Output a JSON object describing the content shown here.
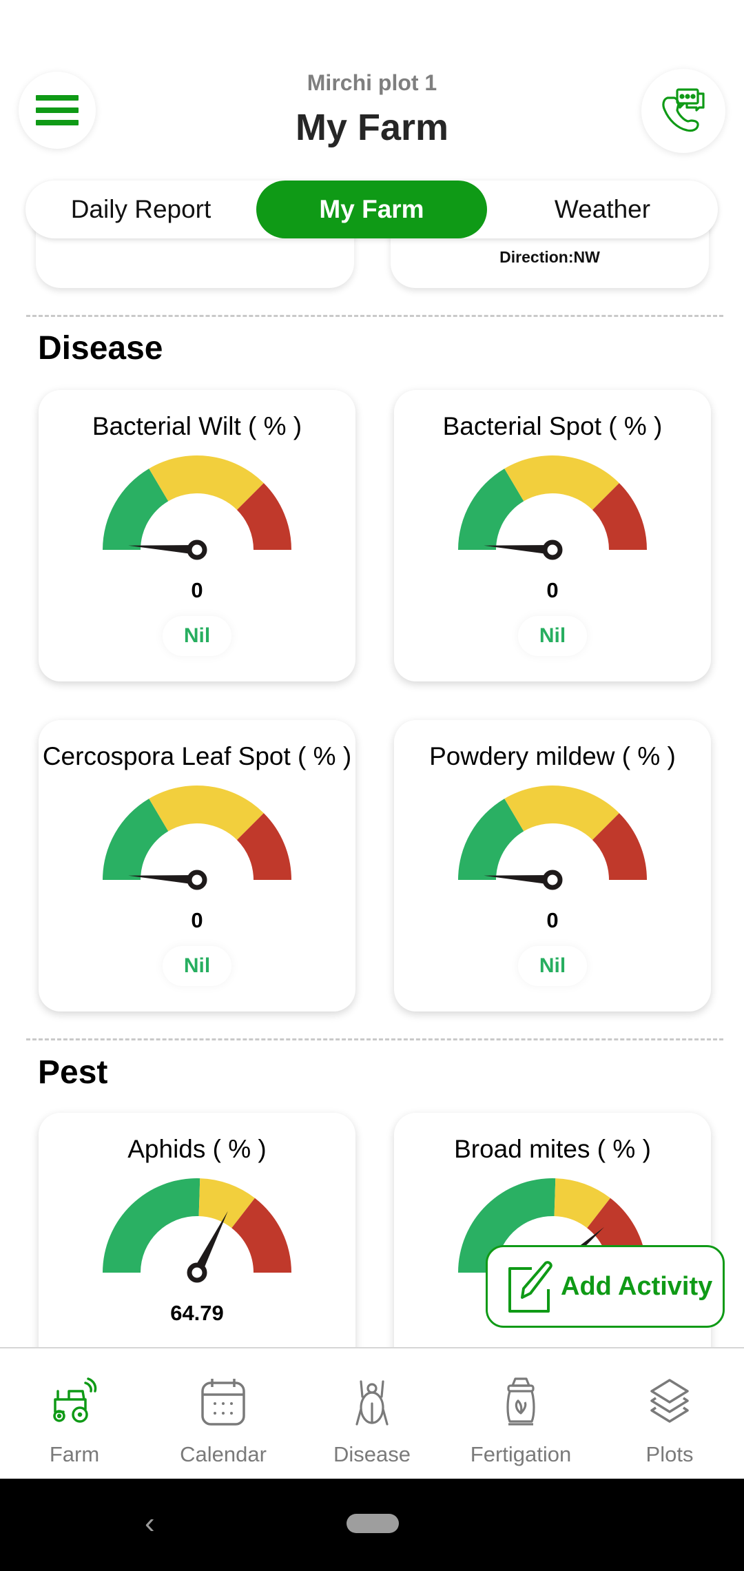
{
  "header": {
    "subtitle": "Mirchi plot 1",
    "title": "My Farm",
    "menu_icon": "hamburger-menu-icon",
    "support_icon": "phone-chat-support-icon"
  },
  "tabs": [
    {
      "label": "Daily Report",
      "active": false
    },
    {
      "label": "My Farm",
      "active": true
    },
    {
      "label": "Weather",
      "active": false
    }
  ],
  "top_cards": {
    "left_text": "",
    "right_text": "Direction:NW"
  },
  "sections": {
    "disease": {
      "title": "Disease",
      "cards": [
        {
          "title": "Bacterial Wilt ( % )",
          "value": "0",
          "status": "Nil"
        },
        {
          "title": "Bacterial Spot ( % )",
          "value": "0",
          "status": "Nil"
        },
        {
          "title": "Cercospora Leaf Spot ( % )",
          "value": "0",
          "status": "Nil"
        },
        {
          "title": "Powdery mildew ( % )",
          "value": "0",
          "status": "Nil"
        }
      ]
    },
    "pest": {
      "title": "Pest",
      "cards": [
        {
          "title": "Aphids ( % )",
          "value": "64.79",
          "status": ""
        },
        {
          "title": "Broad mites ( % )",
          "value": "",
          "status": ""
        }
      ]
    }
  },
  "chart_data": [
    {
      "type": "gauge",
      "title": "Bacterial Wilt ( % )",
      "value": 0,
      "range": [
        0,
        100
      ],
      "zones": [
        {
          "to": 33,
          "color": "#2ab063"
        },
        {
          "to": 75,
          "color": "#f2cf3d"
        },
        {
          "to": 100,
          "color": "#c0392b"
        }
      ],
      "value_label": "0",
      "status": "Nil"
    },
    {
      "type": "gauge",
      "title": "Bacterial Spot ( % )",
      "value": 0,
      "range": [
        0,
        100
      ],
      "zones": [
        {
          "to": 33,
          "color": "#2ab063"
        },
        {
          "to": 75,
          "color": "#f2cf3d"
        },
        {
          "to": 100,
          "color": "#c0392b"
        }
      ],
      "value_label": "0",
      "status": "Nil"
    },
    {
      "type": "gauge",
      "title": "Cercospora Leaf Spot ( % )",
      "value": 0,
      "range": [
        0,
        100
      ],
      "zones": [
        {
          "to": 33,
          "color": "#2ab063"
        },
        {
          "to": 75,
          "color": "#f2cf3d"
        },
        {
          "to": 100,
          "color": "#c0392b"
        }
      ],
      "value_label": "0",
      "status": "Nil"
    },
    {
      "type": "gauge",
      "title": "Powdery mildew ( % )",
      "value": 0,
      "range": [
        0,
        100
      ],
      "zones": [
        {
          "to": 33,
          "color": "#2ab063"
        },
        {
          "to": 75,
          "color": "#f2cf3d"
        },
        {
          "to": 100,
          "color": "#c0392b"
        }
      ],
      "value_label": "0",
      "status": "Nil"
    },
    {
      "type": "gauge",
      "title": "Aphids ( % )",
      "value": 64.79,
      "range": [
        0,
        100
      ],
      "zones": [
        {
          "to": 51,
          "color": "#2ab063"
        },
        {
          "to": 71,
          "color": "#f2cf3d"
        },
        {
          "to": 100,
          "color": "#c0392b"
        }
      ],
      "value_label": "64.79",
      "status": ""
    },
    {
      "type": "gauge",
      "title": "Broad mites ( % )",
      "value": 77,
      "range": [
        0,
        100
      ],
      "zones": [
        {
          "to": 51,
          "color": "#2ab063"
        },
        {
          "to": 71,
          "color": "#f2cf3d"
        },
        {
          "to": 100,
          "color": "#c0392b"
        }
      ],
      "value_label": "",
      "status": ""
    }
  ],
  "fab": {
    "label": "Add Activity",
    "icon": "edit-note-icon"
  },
  "bottom_nav": [
    {
      "label": "Farm",
      "icon": "tractor-icon",
      "active": true
    },
    {
      "label": "Calendar",
      "icon": "calendar-icon",
      "active": false
    },
    {
      "label": "Disease",
      "icon": "bug-icon",
      "active": false
    },
    {
      "label": "Fertigation",
      "icon": "fertilizer-bag-icon",
      "active": false
    },
    {
      "label": "Plots",
      "icon": "layers-icon",
      "active": false
    }
  ],
  "colors": {
    "brand_green": "#0f9a16",
    "status_green": "#27ae60",
    "gauge_green": "#2ab063",
    "gauge_yellow": "#f2cf3d",
    "gauge_red": "#c0392b",
    "nav_gray": "#7a7a7a"
  }
}
